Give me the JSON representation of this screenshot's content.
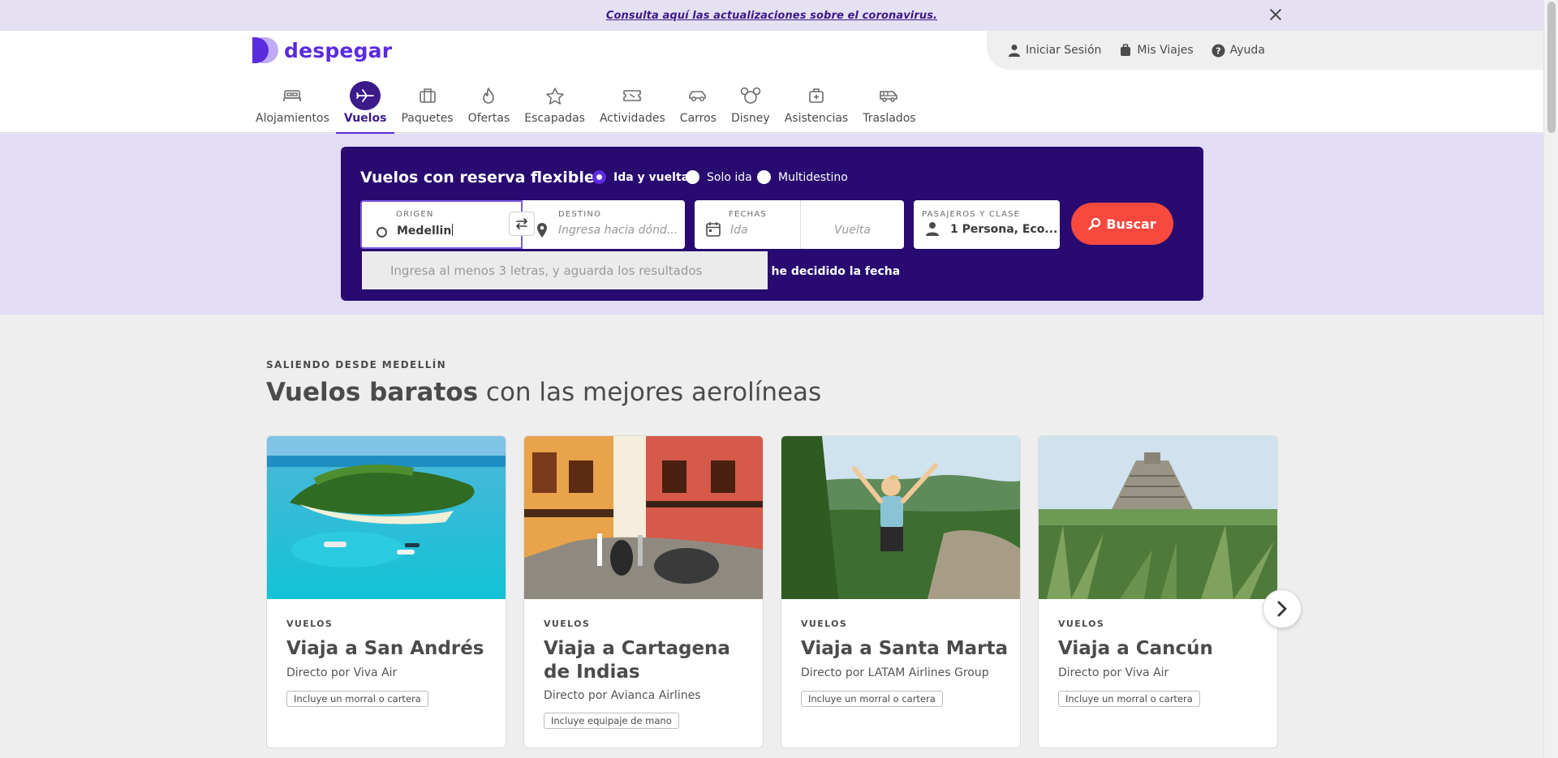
{
  "notice": {
    "text": "Consulta aquí las actualizaciones sobre el coronavirus."
  },
  "brand": {
    "name": "despegar",
    "color": "#5b2bdc"
  },
  "userbar": {
    "login": "Iniciar Sesión",
    "trips": "Mis Viajes",
    "help": "Ayuda"
  },
  "nav": {
    "items": [
      {
        "label": "Alojamientos",
        "icon": "bed-icon"
      },
      {
        "label": "Vuelos",
        "icon": "plane-icon",
        "active": true
      },
      {
        "label": "Paquetes",
        "icon": "suitcase-icon"
      },
      {
        "label": "Ofertas",
        "icon": "flame-icon"
      },
      {
        "label": "Escapadas",
        "icon": "star-icon"
      },
      {
        "label": "Actividades",
        "icon": "ticket-icon"
      },
      {
        "label": "Carros",
        "icon": "car-icon"
      },
      {
        "label": "Disney",
        "icon": "mickey-icon"
      },
      {
        "label": "Asistencias",
        "icon": "medkit-icon"
      },
      {
        "label": "Traslados",
        "icon": "shuttle-icon"
      }
    ]
  },
  "search": {
    "title": "Vuelos con reserva flexible",
    "trip_types": [
      "Ida y vuelta",
      "Solo ida",
      "Multidestino"
    ],
    "selected_trip_type": "Ida y vuelta",
    "origin_label": "ORIGEN",
    "origin_value": "Medellin",
    "destination_label": "DESTINO",
    "destination_placeholder": "Ingresa hacia dónd...",
    "dates_label": "FECHAS",
    "departure_placeholder": "Ida",
    "return_placeholder": "Vuelta",
    "passengers_label": "PASAJEROS Y CLASE",
    "passengers_value": "1 Persona, Eco...",
    "button": "Buscar",
    "undecided_text": "o he decidido la fecha",
    "autocomplete_hint": "Ingresa al menos 3 letras, y aguarda los resultados",
    "accent_color": "#f9493f",
    "panel_color": "#280a70"
  },
  "section": {
    "eyebrow": "SALIENDO DESDE MEDELLÍN",
    "heading_bold": "Vuelos baratos",
    "heading_rest": " con las mejores aerolíneas"
  },
  "cards": [
    {
      "tag": "VUELOS",
      "title": "Viaja a San Andrés",
      "subtitle": "Directo por Viva Air",
      "badge": "Incluye un morral o cartera"
    },
    {
      "tag": "VUELOS",
      "title": "Viaja a Cartagena de Indias",
      "subtitle": "Directo por Avianca Airlines",
      "badge": "Incluye equipaje de mano"
    },
    {
      "tag": "VUELOS",
      "title": "Viaja a Santa Marta",
      "subtitle": "Directo por LATAM Airlines Group",
      "badge": "Incluye un morral o cartera"
    },
    {
      "tag": "VUELOS",
      "title": "Viaja a Cancún",
      "subtitle": "Directo por Viva Air",
      "badge": "Incluye un morral o cartera"
    }
  ]
}
